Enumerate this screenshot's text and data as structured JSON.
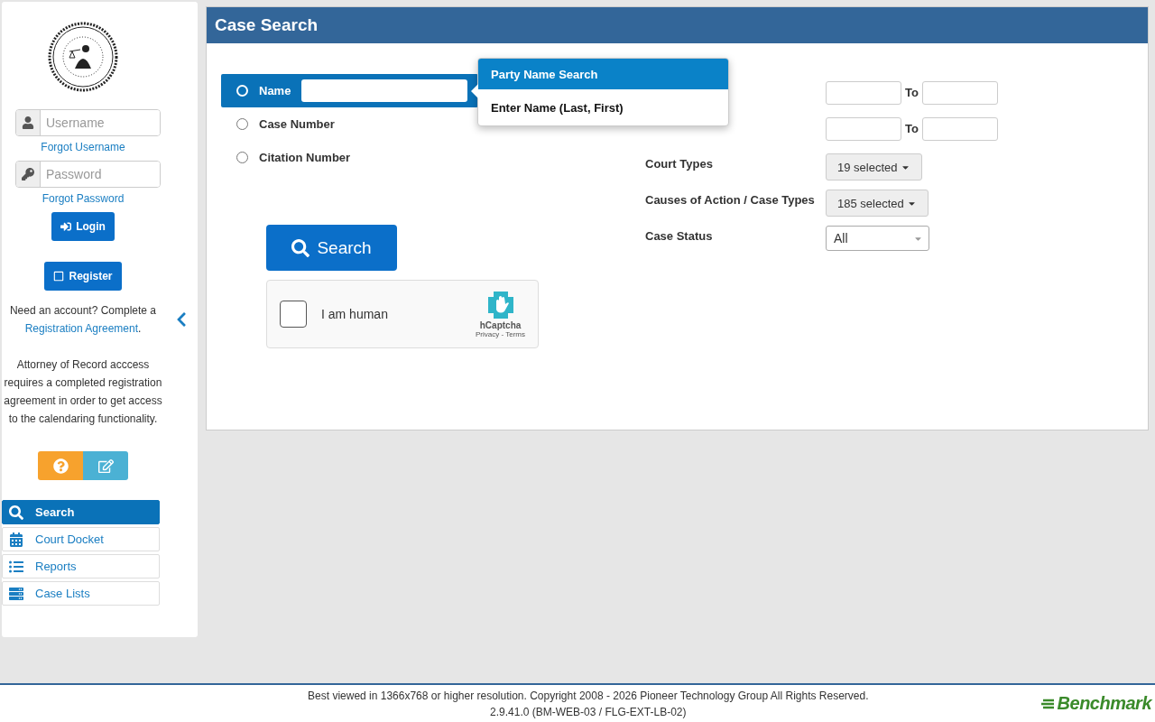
{
  "sidebar": {
    "username": {
      "placeholder": "Username"
    },
    "forgot_username": "Forgot Username",
    "password": {
      "placeholder": "Password"
    },
    "forgot_password": "Forgot Password",
    "login": "Login",
    "register": "Register",
    "account_note": {
      "before": "Need an account? Complete a",
      "link": "Registration Agreement",
      "after": "."
    },
    "attorney_note": "Attorney of Record acccess requires a completed registration agreement in order to get access to the calendaring functionality.",
    "nav": [
      {
        "label": "Search",
        "kind": "search",
        "selected": true
      },
      {
        "label": "Court Docket",
        "kind": "calendar",
        "selected": false
      },
      {
        "label": "Reports",
        "kind": "list",
        "selected": false
      },
      {
        "label": "Case Lists",
        "kind": "stack",
        "selected": false
      }
    ]
  },
  "panel": {
    "title": "Case Search",
    "search_types": [
      {
        "label": "Name",
        "selected": true
      },
      {
        "label": "Case Number",
        "selected": false
      },
      {
        "label": "Citation Number",
        "selected": false
      }
    ],
    "popover": {
      "title": "Party Name Search",
      "text": "Enter Name (Last, First)"
    },
    "filters": [
      {
        "kind": "date_range",
        "to": "To"
      },
      {
        "kind": "date_range",
        "to": "To"
      },
      {
        "kind": "multiselect",
        "label": "Court Types",
        "value": "19 selected"
      },
      {
        "kind": "multiselect",
        "label": "Causes of Action / Case Types",
        "value": "185 selected"
      },
      {
        "kind": "select",
        "label": "Case Status",
        "value": "All"
      }
    ],
    "search_button": "Search",
    "captcha": {
      "checked": false,
      "label": "I am human",
      "brand": "hCaptcha",
      "links": "Privacy - Terms"
    }
  },
  "footer": {
    "copyright": "Best viewed in 1366x768 or higher resolution. Copyright 2008 - 2026 Pioneer Technology Group All Rights Reserved.",
    "version": "2.9.41.0 (BM-WEB-03 / FLG-EXT-LB-02)",
    "brand": "Benchmark"
  }
}
